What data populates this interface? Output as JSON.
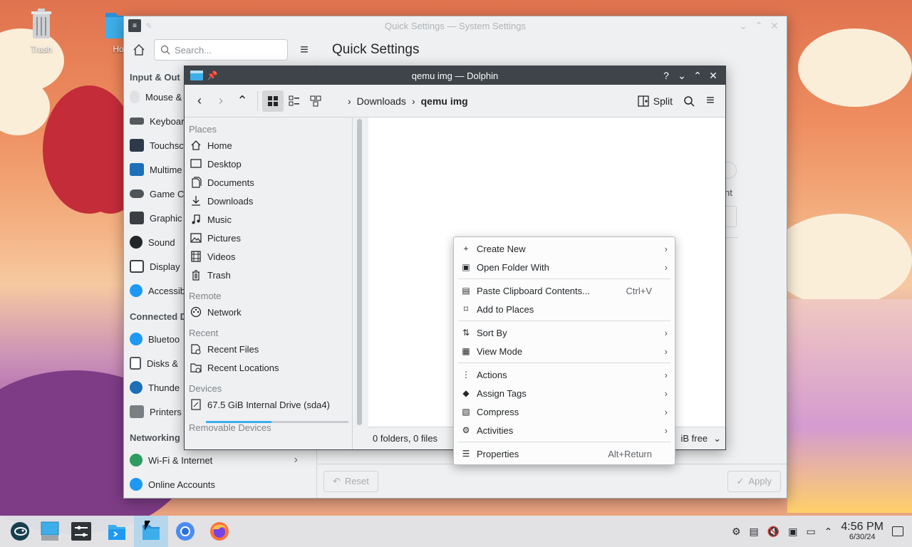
{
  "desktop": {
    "icons": [
      {
        "label": "Trash",
        "icon": "trash-icon"
      },
      {
        "label": "Ho",
        "icon": "home-folder-icon"
      }
    ]
  },
  "settings_window": {
    "title": "Quick Settings — System Settings",
    "search_placeholder": "Search...",
    "page_title": "Quick Settings",
    "sections": [
      {
        "title": "Input & Out",
        "items": [
          {
            "label": "Mouse &",
            "icon": "mouse-icon"
          },
          {
            "label": "Keyboar",
            "icon": "keyboard-icon"
          },
          {
            "label": "Touchsc",
            "icon": "touchscreen-icon"
          },
          {
            "label": "Multime",
            "icon": "multimedia-icon"
          },
          {
            "label": "Game C",
            "icon": "gamepad-icon"
          },
          {
            "label": "Graphic",
            "icon": "graphic-tablet-icon"
          },
          {
            "label": "Sound",
            "icon": "sound-icon"
          },
          {
            "label": "Display",
            "icon": "display-icon"
          },
          {
            "label": "Accessib",
            "icon": "accessibility-icon"
          }
        ]
      },
      {
        "title": "Connected D",
        "items": [
          {
            "label": "Bluetoo",
            "icon": "bluetooth-icon"
          },
          {
            "label": "Disks &",
            "icon": "disks-icon"
          },
          {
            "label": "Thunde",
            "icon": "thunderbolt-icon"
          },
          {
            "label": "Printers",
            "icon": "printer-icon"
          }
        ]
      },
      {
        "title": "Networking",
        "items": [
          {
            "label": "Wi-Fi & Internet",
            "icon": "wifi-icon"
          },
          {
            "label": "Online Accounts",
            "icon": "online-accounts-icon"
          }
        ]
      }
    ],
    "right_fragment": "nt",
    "reset_label": "Reset",
    "apply_label": "Apply"
  },
  "dolphin": {
    "title": "qemu img — Dolphin",
    "breadcrumb": [
      "Downloads",
      "qemu img"
    ],
    "split_label": "Split",
    "places": [
      {
        "heading": "Places",
        "items": [
          {
            "label": "Home",
            "icon": "home-icon"
          },
          {
            "label": "Desktop",
            "icon": "desktop-icon"
          },
          {
            "label": "Documents",
            "icon": "documents-icon"
          },
          {
            "label": "Downloads",
            "icon": "downloads-icon"
          },
          {
            "label": "Music",
            "icon": "music-icon"
          },
          {
            "label": "Pictures",
            "icon": "pictures-icon"
          },
          {
            "label": "Videos",
            "icon": "videos-icon"
          },
          {
            "label": "Trash",
            "icon": "trash-icon"
          }
        ]
      },
      {
        "heading": "Remote",
        "items": [
          {
            "label": "Network",
            "icon": "network-icon"
          }
        ]
      },
      {
        "heading": "Recent",
        "items": [
          {
            "label": "Recent Files",
            "icon": "recent-files-icon"
          },
          {
            "label": "Recent Locations",
            "icon": "recent-locations-icon"
          }
        ]
      },
      {
        "heading": "Devices",
        "items": [
          {
            "label": "67.5 GiB Internal Drive (sda4)",
            "icon": "drive-icon"
          }
        ]
      },
      {
        "heading": "Removable Devices",
        "items": []
      }
    ],
    "drive_usage_fraction": 0.46,
    "status_left": "0 folders, 0 files",
    "status_right": "iB free"
  },
  "context_menu": {
    "groups": [
      [
        {
          "label": "Create New",
          "icon": "plus-icon",
          "submenu": true,
          "shortcut": ""
        },
        {
          "label": "Open Folder With",
          "icon": "open-with-icon",
          "submenu": true,
          "shortcut": ""
        }
      ],
      [
        {
          "label": "Paste Clipboard Contents...",
          "icon": "paste-icon",
          "submenu": false,
          "shortcut": "Ctrl+V"
        },
        {
          "label": "Add to Places",
          "icon": "bookmark-icon",
          "submenu": false,
          "shortcut": ""
        }
      ],
      [
        {
          "label": "Sort By",
          "icon": "sort-icon",
          "submenu": true,
          "shortcut": ""
        },
        {
          "label": "View Mode",
          "icon": "view-mode-icon",
          "submenu": true,
          "shortcut": ""
        }
      ],
      [
        {
          "label": "Actions",
          "icon": "actions-icon",
          "submenu": true,
          "shortcut": ""
        },
        {
          "label": "Assign Tags",
          "icon": "tag-icon",
          "submenu": true,
          "shortcut": ""
        },
        {
          "label": "Compress",
          "icon": "compress-icon",
          "submenu": true,
          "shortcut": ""
        },
        {
          "label": "Activities",
          "icon": "activities-icon",
          "submenu": true,
          "shortcut": ""
        }
      ],
      [
        {
          "label": "Properties",
          "icon": "properties-icon",
          "submenu": false,
          "shortcut": "Alt+Return"
        }
      ]
    ]
  },
  "taskbar": {
    "apps": [
      {
        "name": "app-launcher",
        "active": false
      },
      {
        "name": "show-desktop",
        "active": false
      },
      {
        "name": "system-settings",
        "active": false
      },
      {
        "name": "discover",
        "active": false
      },
      {
        "name": "dolphin",
        "active": true
      },
      {
        "name": "chromium",
        "active": false
      },
      {
        "name": "firefox",
        "active": false
      }
    ],
    "time": "4:56 PM",
    "date": "6/30/24"
  },
  "colors": {
    "accent": "#3daee9",
    "titlebar_active": "#3e4449",
    "window_bg": "#eff0f1"
  }
}
